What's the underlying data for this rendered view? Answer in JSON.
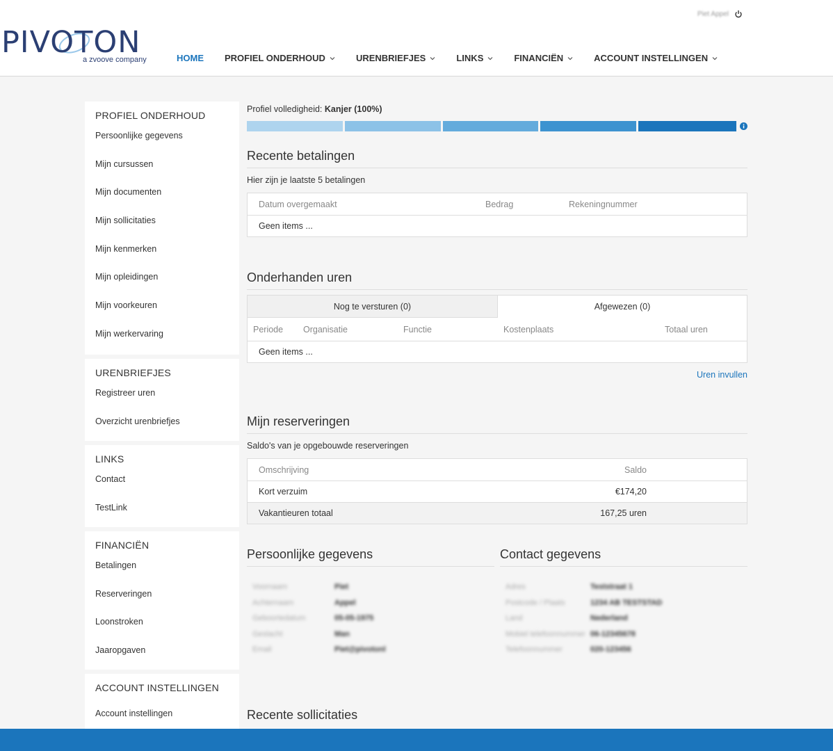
{
  "header": {
    "logo_text": "PIVOTON",
    "logo_sub": "a zvoove company",
    "user_name": "Piet Appel",
    "nav": [
      {
        "label": "HOME",
        "active": true,
        "dropdown": false
      },
      {
        "label": "PROFIEL ONDERHOUD",
        "active": false,
        "dropdown": true
      },
      {
        "label": "URENBRIEFJES",
        "active": false,
        "dropdown": true
      },
      {
        "label": "LINKS",
        "active": false,
        "dropdown": true
      },
      {
        "label": "FINANCIËN",
        "active": false,
        "dropdown": true
      },
      {
        "label": "ACCOUNT INSTELLINGEN",
        "active": false,
        "dropdown": true
      }
    ]
  },
  "sidebar": {
    "profiel": {
      "title": "PROFIEL ONDERHOUD",
      "items": [
        "Persoonlijke gegevens",
        "Mijn cursussen",
        "Mijn documenten",
        "Mijn sollicitaties",
        "Mijn kenmerken",
        "Mijn opleidingen",
        "Mijn voorkeuren",
        "Mijn werkervaring"
      ]
    },
    "uren": {
      "title": "URENBRIEFJES",
      "items": [
        "Registreer uren",
        "Overzicht urenbriefjes"
      ]
    },
    "links": {
      "title": "LINKS",
      "items": [
        "Contact",
        "TestLink"
      ]
    },
    "fin": {
      "title": "FINANCIËN",
      "items": [
        "Betalingen",
        "Reserveringen",
        "Loonstroken",
        "Jaaropgaven"
      ]
    },
    "account": {
      "title": "ACCOUNT INSTELLINGEN",
      "items": [
        "Account instellingen"
      ]
    }
  },
  "profile": {
    "label": "Profiel volledigheid:",
    "value": "Kanjer (100%)",
    "progress": 1.0,
    "segment_colors": [
      "#aed4ee",
      "#8cc2e7",
      "#63abdc",
      "#3d93d0",
      "#1b75bc"
    ]
  },
  "betalingen": {
    "title": "Recente betalingen",
    "subtitle": "Hier zijn je laatste 5 betalingen",
    "headers": [
      "Datum overgemaakt",
      "Bedrag",
      "Rekeningnummer"
    ],
    "empty": "Geen items ..."
  },
  "uren": {
    "title": "Onderhanden uren",
    "tabs": [
      "Nog te versturen (0)",
      "Afgewezen (0)"
    ],
    "headers": [
      "Periode",
      "Organisatie",
      "Functie",
      "Kostenplaats",
      "Totaal uren"
    ],
    "empty": "Geen items ...",
    "link": "Uren invullen"
  },
  "reserveringen": {
    "title": "Mijn reserveringen",
    "subtitle": "Saldo's van je opgebouwde reserveringen",
    "headers": [
      "Omschrijving",
      "Saldo"
    ],
    "rows": [
      {
        "label": "Kort verzuim",
        "value": "€174,20"
      },
      {
        "label": "Vakantieuren totaal",
        "value": "167,25 uren"
      }
    ]
  },
  "persoonlijk": {
    "title": "Persoonlijke gegevens",
    "rows": [
      [
        "Voornaam",
        "Piet"
      ],
      [
        "Achternaam",
        "Appel"
      ],
      [
        "Geboortedatum",
        "05-05-1975"
      ],
      [
        "Geslacht",
        "Man"
      ],
      [
        "Email",
        "Piet@pivotonl"
      ]
    ]
  },
  "contact": {
    "title": "Contact gegevens",
    "rows": [
      [
        "Adres",
        "Teststraat 1"
      ],
      [
        "Postcode / Plaats",
        "1234 AB TESTSTAD"
      ],
      [
        "Land",
        "Nederland"
      ],
      [
        "Mobiel telefoonnummer",
        "06-12345678"
      ],
      [
        "Telefoonnummer",
        "020-123456"
      ]
    ]
  },
  "sollicitaties": {
    "title": "Recente sollicitaties"
  },
  "colors": {
    "primary": "#1b75bc",
    "logo": "#2b3f73"
  }
}
